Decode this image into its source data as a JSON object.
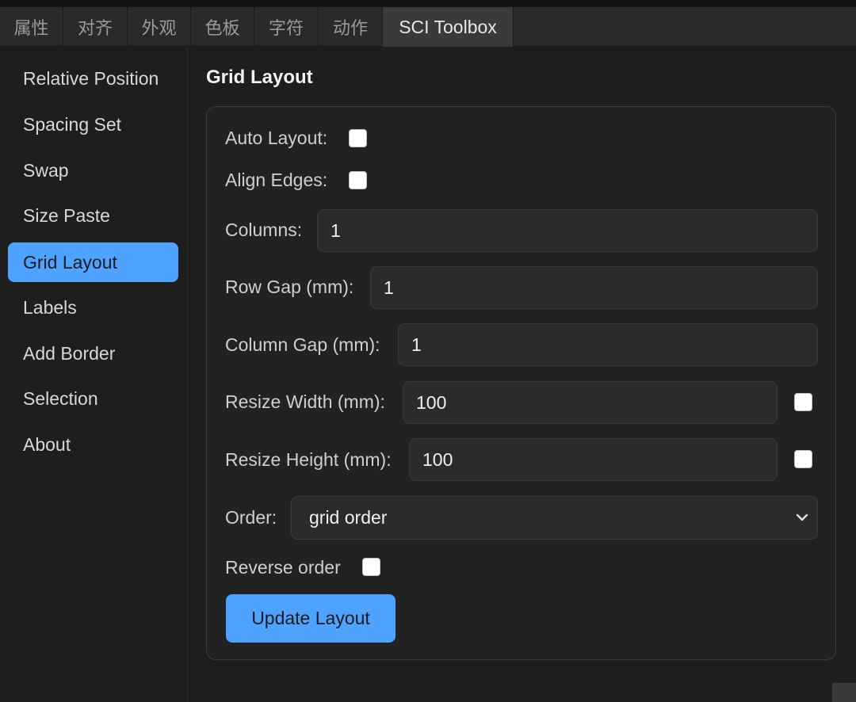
{
  "tabs": [
    "属性",
    "对齐",
    "外观",
    "色板",
    "字符",
    "动作",
    "SCI Toolbox"
  ],
  "sidebar": {
    "items": [
      "Relative Position",
      "Spacing Set",
      "Swap",
      "Size Paste",
      "Grid Layout",
      "Labels",
      "Add Border",
      "Selection",
      "About"
    ],
    "active": "Grid Layout"
  },
  "page": {
    "title": "Grid Layout",
    "auto_layout_label": "Auto Layout:",
    "align_edges_label": "Align Edges:",
    "columns_label": "Columns:",
    "columns_value": "1",
    "row_gap_label": "Row Gap (mm):",
    "row_gap_value": "1",
    "column_gap_label": "Column Gap (mm):",
    "column_gap_value": "1",
    "resize_width_label": "Resize Width (mm):",
    "resize_width_value": "100",
    "resize_height_label": "Resize Height (mm):",
    "resize_height_value": "100",
    "order_label": "Order:",
    "order_value": "grid order",
    "reverse_order_label": "Reverse order",
    "update_button": "Update Layout"
  },
  "colors": {
    "accent": "#4da3ff",
    "background": "#1e1e1e",
    "panel": "#222222",
    "field": "#2b2b2b"
  }
}
